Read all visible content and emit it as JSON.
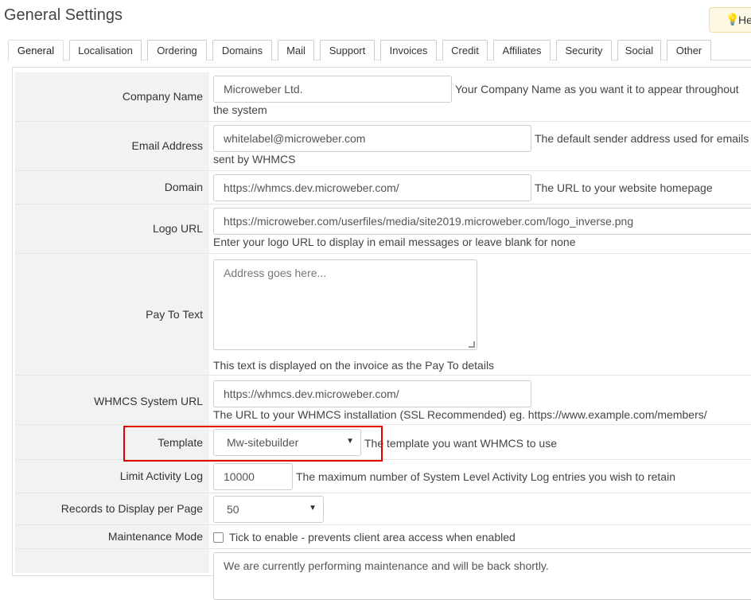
{
  "page": {
    "title": "General Settings"
  },
  "help": {
    "label": "Help",
    "icon": "lightbulb-icon"
  },
  "tabs": [
    "General",
    "Localisation",
    "Ordering",
    "Domains",
    "Mail",
    "Support",
    "Invoices",
    "Credit",
    "Affiliates",
    "Security",
    "Social",
    "Other"
  ],
  "active_tab": "General",
  "fields": {
    "company_name": {
      "label": "Company Name",
      "value": "Microweber Ltd.",
      "help_line1": "Your Company Name as you want it to appear throughout",
      "help_line2": "the system"
    },
    "email_address": {
      "label": "Email Address",
      "value": "whitelabel@microweber.com",
      "help_line1": "The default sender address used for emails",
      "help_line2": "sent by WHMCS"
    },
    "domain": {
      "label": "Domain",
      "value": "https://whmcs.dev.microweber.com/",
      "help": "The URL to your website homepage"
    },
    "logo_url": {
      "label": "Logo URL",
      "value": "https://microweber.com/userfiles/media/site2019.microweber.com/logo_inverse.png",
      "help": "Enter your logo URL to display in email messages or leave blank for none"
    },
    "pay_to_text": {
      "label": "Pay To Text",
      "placeholder": "Address goes here...",
      "help": "This text is displayed on the invoice as the Pay To details"
    },
    "system_url": {
      "label": "WHMCS System URL",
      "value": "https://whmcs.dev.microweber.com/",
      "help": "The URL to your WHMCS installation (SSL Recommended) eg. https://www.example.com/members/"
    },
    "template": {
      "label": "Template",
      "selected": "Mw-sitebuilder",
      "help": "The template you want WHMCS to use"
    },
    "limit_activity_log": {
      "label": "Limit Activity Log",
      "value": "10000",
      "help": "The maximum number of System Level Activity Log entries you wish to retain"
    },
    "records_per_page": {
      "label": "Records to Display per Page",
      "selected": "50"
    },
    "maintenance_mode": {
      "label": "Maintenance Mode",
      "checked": false,
      "help": "Tick to enable - prevents client area access when enabled"
    },
    "maintenance_message": {
      "value": "We are currently performing maintenance and will be back shortly."
    }
  },
  "colors": {
    "highlight": "#e00000",
    "label_bg": "#f2f2f2"
  }
}
